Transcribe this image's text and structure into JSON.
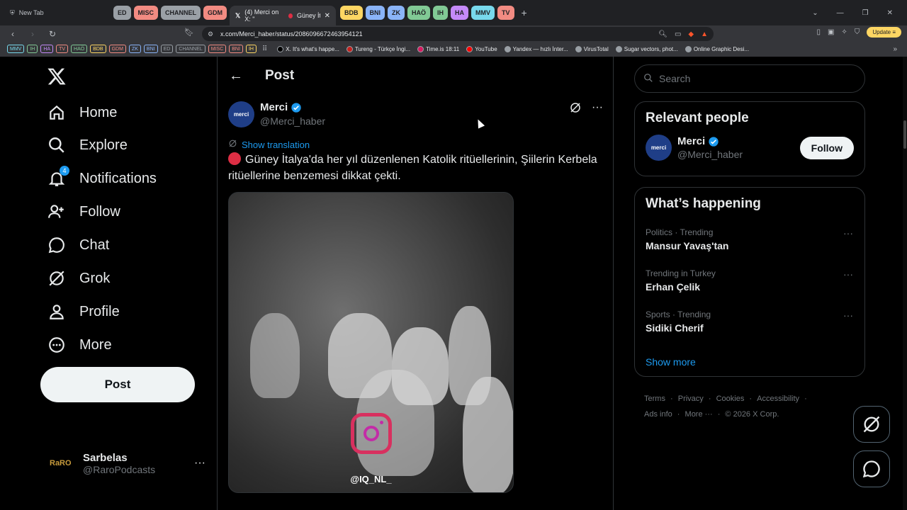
{
  "browser": {
    "first_tab": "New Tab",
    "tab_groups_left": [
      {
        "label": "ED",
        "color": "#9aa0a6"
      },
      {
        "label": "MISC",
        "color": "#f28b82"
      },
      {
        "label": "CHANNEL",
        "color": "#9aa0a6"
      },
      {
        "label": "GDM",
        "color": "#f28b82"
      }
    ],
    "active_tab": "(4) Merci on X: \"",
    "active_tab_suffix": "Güney İtalya",
    "tab_groups_right": [
      {
        "label": "BDB",
        "color": "#fdd663"
      },
      {
        "label": "BNI",
        "color": "#8ab4f8"
      },
      {
        "label": "ZK",
        "color": "#8ab4f8"
      },
      {
        "label": "HAÖ",
        "color": "#81c995"
      },
      {
        "label": "IH",
        "color": "#81c995"
      },
      {
        "label": "HA",
        "color": "#c58af9"
      },
      {
        "label": "MMV",
        "color": "#78d9ec"
      },
      {
        "label": "TV",
        "color": "#f28b82"
      }
    ],
    "url": "x.com/Merci_haber/status/2086096672463954121",
    "update_label": "Update",
    "bookmark_groups": [
      {
        "label": "MMV",
        "color": "#78d9ec"
      },
      {
        "label": "IH",
        "color": "#81c995"
      },
      {
        "label": "HA",
        "color": "#c58af9"
      },
      {
        "label": "TV",
        "color": "#f28b82"
      },
      {
        "label": "HAÖ",
        "color": "#81c995"
      },
      {
        "label": "BDB",
        "color": "#fdd663"
      },
      {
        "label": "GDM",
        "color": "#f28b82"
      },
      {
        "label": "ZK",
        "color": "#8ab4f8"
      },
      {
        "label": "BNI",
        "color": "#8ab4f8"
      },
      {
        "label": "ED",
        "color": "#9aa0a6"
      },
      {
        "label": "CHANNEL",
        "color": "#9aa0a6"
      },
      {
        "label": "MISC",
        "color": "#f28b82"
      },
      {
        "label": "BNİ",
        "color": "#f28b82"
      },
      {
        "label": "İH",
        "color": "#fdd663"
      }
    ],
    "bookmarks": [
      {
        "label": "X. It's what's happe...",
        "color": "#000000"
      },
      {
        "label": "Tureng - Türkçe İngi...",
        "color": "#c5221f"
      },
      {
        "label": "Time.is 18:11",
        "color": "#d81b60"
      },
      {
        "label": "YouTube",
        "color": "#ff0000"
      },
      {
        "label": "Yandex — hızlı İnter...",
        "color": "#9aa0a6"
      },
      {
        "label": "VirusTotal",
        "color": "#9aa0a6"
      },
      {
        "label": "Sugar vectors, phot...",
        "color": "#9aa0a6"
      },
      {
        "label": "Online Graphic Desi...",
        "color": "#9aa0a6"
      }
    ]
  },
  "sidebar": {
    "items": [
      {
        "label": "Home",
        "icon": "home-icon"
      },
      {
        "label": "Explore",
        "icon": "search-icon"
      },
      {
        "label": "Notifications",
        "icon": "bell-icon",
        "badge": "4"
      },
      {
        "label": "Follow",
        "icon": "follow-icon"
      },
      {
        "label": "Chat",
        "icon": "chat-icon"
      },
      {
        "label": "Grok",
        "icon": "grok-icon"
      },
      {
        "label": "Profile",
        "icon": "profile-icon"
      },
      {
        "label": "More",
        "icon": "more-icon"
      }
    ],
    "post_button": "Post",
    "account": {
      "name": "Sarbelas",
      "handle": "@RaroPodcasts",
      "avatar_text": "RaRO"
    }
  },
  "post": {
    "header": "Post",
    "author_name": "Merci",
    "author_handle": "@Merci_haber",
    "avatar_text": "merci",
    "show_translation": "Show translation",
    "text": "Güney İtalya'da her yıl düzenlenen Katolik ritüellerinin, Şiilerin Kerbela ritüellerine benzemesi dikkat çekti.",
    "media_watermark": "@IQ_NL_"
  },
  "right": {
    "search_placeholder": "Search",
    "relevant_title": "Relevant people",
    "relevant_person": {
      "name": "Merci",
      "handle": "@Merci_haber",
      "avatar_text": "merci",
      "follow_label": "Follow"
    },
    "happening_title": "What’s happening",
    "trends": [
      {
        "meta": "Politics · Trending",
        "name": "Mansur Yavaş'tan"
      },
      {
        "meta": "Trending in Turkey",
        "name": "Erhan Çelik"
      },
      {
        "meta": "Sports · Trending",
        "name": "Sidiki Cherif"
      }
    ],
    "show_more": "Show more",
    "footer": [
      "Terms",
      "Privacy",
      "Cookies",
      "Accessibility",
      "Ads info",
      "More ···",
      "© 2026 X Corp."
    ]
  },
  "colors": {
    "accent": "#1d9bf0",
    "verified": "#1d9bf0",
    "border": "#2f3336"
  }
}
